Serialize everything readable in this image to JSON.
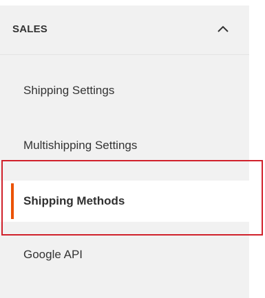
{
  "section": {
    "title": "SALES",
    "toggle_icon": "chevron-up-icon"
  },
  "nav": {
    "items": [
      {
        "label": "Shipping Settings",
        "active": false
      },
      {
        "label": "Multishipping Settings",
        "active": false
      },
      {
        "label": "Shipping Methods",
        "active": true
      },
      {
        "label": "Google API",
        "active": false
      }
    ]
  },
  "colors": {
    "panel_bg": "#f1f1f1",
    "active_bg": "#ffffff",
    "active_accent": "#eb5202",
    "highlight_border": "#d0202a",
    "text": "#333333"
  }
}
